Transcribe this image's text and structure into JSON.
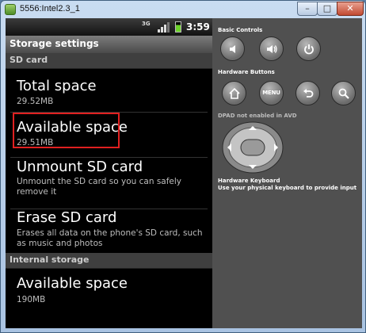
{
  "window": {
    "title": "5556:Intel2.3_1",
    "minimize_label": "–",
    "maximize_label": "□",
    "close_label": "✕"
  },
  "statusbar": {
    "network": "3G",
    "time": "3:59",
    "battery_level": 0.7
  },
  "screen": {
    "title": "Storage settings",
    "sd_card_header": "SD card",
    "total_space": {
      "title": "Total space",
      "summary": "29.52MB"
    },
    "available_space": {
      "title": "Available space",
      "summary": "29.51MB"
    },
    "unmount": {
      "title": "Unmount SD card",
      "summary": "Unmount the SD card so you can safely remove it"
    },
    "erase": {
      "title": "Erase SD card",
      "summary": "Erases all data on the phone's SD card, such as music and photos"
    },
    "internal_header": "Internal storage",
    "internal_available": {
      "title": "Available space",
      "summary": "190MB"
    }
  },
  "controls": {
    "basic_label": "Basic Controls",
    "hardware_label": "Hardware Buttons",
    "menu_label": "MENU",
    "dpad_label": "DPAD not enabled in AVD",
    "keyboard_label": "Hardware Keyboard",
    "keyboard_hint": "Use your physical keyboard to provide input"
  },
  "icons": {
    "volume_down": "volume-down-icon",
    "volume_up": "volume-up-icon",
    "power": "power-icon",
    "home": "home-icon",
    "back": "back-icon",
    "search": "search-icon"
  },
  "colors": {
    "highlight": "#e02020",
    "battery": "#6cd32a",
    "controls_bg": "#505050"
  }
}
